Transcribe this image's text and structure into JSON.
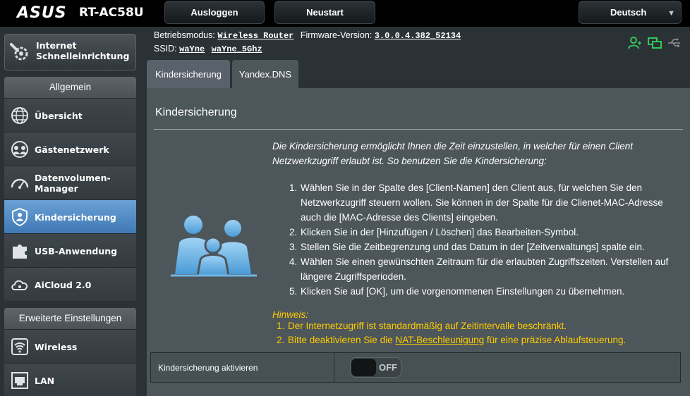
{
  "header": {
    "brand": "ASUS",
    "model": "RT-AC58U",
    "logout_label": "Ausloggen",
    "reboot_label": "Neustart",
    "language": "Deutsch"
  },
  "info": {
    "mode_label": "Betriebsmodus:",
    "mode_value": "Wireless Router",
    "firmware_label": "Firmware-Version:",
    "firmware_value": "3.0.0.4.382_52134",
    "ssid_label": "SSID:",
    "ssid_1": "waYne",
    "ssid_2": "waYne_5Ghz",
    "status_icons": [
      "user-client-icon",
      "network-icon",
      "usb-icon"
    ]
  },
  "sidebar": {
    "qis_label": "Internet Schnelleinrichtung",
    "general_header": "Allgemein",
    "general_items": [
      {
        "label": "Übersicht",
        "icon": "globe-map-icon"
      },
      {
        "label": "Gästenetzwerk",
        "icon": "guest-globe-icon"
      },
      {
        "label": "Datenvolumen-Manager",
        "icon": "speedometer-icon"
      },
      {
        "label": "Kindersicherung",
        "icon": "parental-shield-icon"
      },
      {
        "label": "USB-Anwendung",
        "icon": "puzzle-icon"
      },
      {
        "label": "AiCloud 2.0",
        "icon": "cloud-icon"
      }
    ],
    "advanced_header": "Erweiterte Einstellungen",
    "advanced_items": [
      {
        "label": "Wireless",
        "icon": "wifi-icon"
      },
      {
        "label": "LAN",
        "icon": "lan-icon"
      }
    ]
  },
  "tabs": [
    {
      "label": "Kindersicherung"
    },
    {
      "label": "Yandex.DNS"
    }
  ],
  "main": {
    "title": "Kindersicherung",
    "description": "Die Kindersicherung ermöglicht Ihnen die Zeit einzustellen, in welcher für einen Client Netzwerkzugriff erlaubt ist. So benutzen Sie die Kindersicherung:",
    "steps": [
      "Wählen Sie in der Spalte des [Client-Namen] den Client aus, für welchen Sie den Netzwerkzugriff steuern wollen. Sie können in der Spalte für die Clienet-MAC-Adresse auch die [MAC-Adresse des Clients] eingeben.",
      "Klicken Sie in der [Hinzufügen / Löschen] das Bearbeiten-Symbol.",
      "Stellen Sie die Zeitbegrenzung und das Datum in der [Zeitverwaltungs] spalte ein.",
      "Wählen Sie einen gewünschten Zeitraum für die erlaubten Zugriffszeiten. Verstellen auf längere Zugriffsperioden.",
      "Klicken Sie auf [OK], um die vorgenommenen Einstellungen zu übernehmen."
    ],
    "step_numbers": [
      "1.",
      "2.",
      "3.",
      "4.",
      "5."
    ],
    "hint_title": "Hinweis:",
    "hint_1": "Der Internetzugriff ist standardmäßig auf Zeitintervalle beschränkt.",
    "hint_2_pre": "Bitte deaktivieren Sie die ",
    "hint_2_link": "NAT-Beschleunigung",
    "hint_2_post": " für eine präzise Ablaufsteuerung.",
    "hint_numbers": [
      "1.",
      "2."
    ],
    "setting_label": "Kindersicherung aktivieren",
    "toggle_state": "OFF"
  },
  "colors": {
    "active_item": "#4a86c3",
    "hint": "#ffcc00",
    "status_green": "#34c759"
  }
}
